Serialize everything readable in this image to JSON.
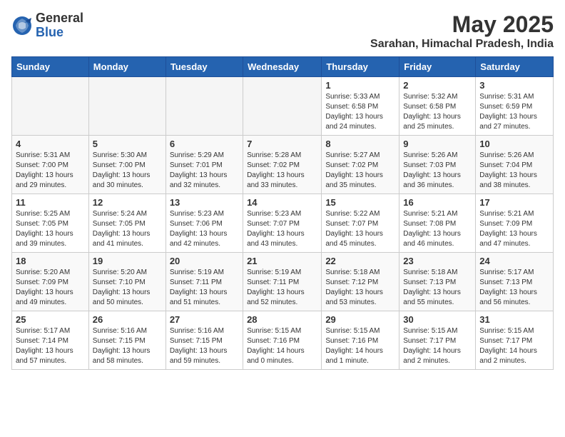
{
  "logo": {
    "general": "General",
    "blue": "Blue"
  },
  "title": "May 2025",
  "location": "Sarahan, Himachal Pradesh, India",
  "days_of_week": [
    "Sunday",
    "Monday",
    "Tuesday",
    "Wednesday",
    "Thursday",
    "Friday",
    "Saturday"
  ],
  "weeks": [
    [
      {
        "day": "",
        "info": ""
      },
      {
        "day": "",
        "info": ""
      },
      {
        "day": "",
        "info": ""
      },
      {
        "day": "",
        "info": ""
      },
      {
        "day": "1",
        "info": "Sunrise: 5:33 AM\nSunset: 6:58 PM\nDaylight: 13 hours\nand 24 minutes."
      },
      {
        "day": "2",
        "info": "Sunrise: 5:32 AM\nSunset: 6:58 PM\nDaylight: 13 hours\nand 25 minutes."
      },
      {
        "day": "3",
        "info": "Sunrise: 5:31 AM\nSunset: 6:59 PM\nDaylight: 13 hours\nand 27 minutes."
      }
    ],
    [
      {
        "day": "4",
        "info": "Sunrise: 5:31 AM\nSunset: 7:00 PM\nDaylight: 13 hours\nand 29 minutes."
      },
      {
        "day": "5",
        "info": "Sunrise: 5:30 AM\nSunset: 7:00 PM\nDaylight: 13 hours\nand 30 minutes."
      },
      {
        "day": "6",
        "info": "Sunrise: 5:29 AM\nSunset: 7:01 PM\nDaylight: 13 hours\nand 32 minutes."
      },
      {
        "day": "7",
        "info": "Sunrise: 5:28 AM\nSunset: 7:02 PM\nDaylight: 13 hours\nand 33 minutes."
      },
      {
        "day": "8",
        "info": "Sunrise: 5:27 AM\nSunset: 7:02 PM\nDaylight: 13 hours\nand 35 minutes."
      },
      {
        "day": "9",
        "info": "Sunrise: 5:26 AM\nSunset: 7:03 PM\nDaylight: 13 hours\nand 36 minutes."
      },
      {
        "day": "10",
        "info": "Sunrise: 5:26 AM\nSunset: 7:04 PM\nDaylight: 13 hours\nand 38 minutes."
      }
    ],
    [
      {
        "day": "11",
        "info": "Sunrise: 5:25 AM\nSunset: 7:05 PM\nDaylight: 13 hours\nand 39 minutes."
      },
      {
        "day": "12",
        "info": "Sunrise: 5:24 AM\nSunset: 7:05 PM\nDaylight: 13 hours\nand 41 minutes."
      },
      {
        "day": "13",
        "info": "Sunrise: 5:23 AM\nSunset: 7:06 PM\nDaylight: 13 hours\nand 42 minutes."
      },
      {
        "day": "14",
        "info": "Sunrise: 5:23 AM\nSunset: 7:07 PM\nDaylight: 13 hours\nand 43 minutes."
      },
      {
        "day": "15",
        "info": "Sunrise: 5:22 AM\nSunset: 7:07 PM\nDaylight: 13 hours\nand 45 minutes."
      },
      {
        "day": "16",
        "info": "Sunrise: 5:21 AM\nSunset: 7:08 PM\nDaylight: 13 hours\nand 46 minutes."
      },
      {
        "day": "17",
        "info": "Sunrise: 5:21 AM\nSunset: 7:09 PM\nDaylight: 13 hours\nand 47 minutes."
      }
    ],
    [
      {
        "day": "18",
        "info": "Sunrise: 5:20 AM\nSunset: 7:09 PM\nDaylight: 13 hours\nand 49 minutes."
      },
      {
        "day": "19",
        "info": "Sunrise: 5:20 AM\nSunset: 7:10 PM\nDaylight: 13 hours\nand 50 minutes."
      },
      {
        "day": "20",
        "info": "Sunrise: 5:19 AM\nSunset: 7:11 PM\nDaylight: 13 hours\nand 51 minutes."
      },
      {
        "day": "21",
        "info": "Sunrise: 5:19 AM\nSunset: 7:11 PM\nDaylight: 13 hours\nand 52 minutes."
      },
      {
        "day": "22",
        "info": "Sunrise: 5:18 AM\nSunset: 7:12 PM\nDaylight: 13 hours\nand 53 minutes."
      },
      {
        "day": "23",
        "info": "Sunrise: 5:18 AM\nSunset: 7:13 PM\nDaylight: 13 hours\nand 55 minutes."
      },
      {
        "day": "24",
        "info": "Sunrise: 5:17 AM\nSunset: 7:13 PM\nDaylight: 13 hours\nand 56 minutes."
      }
    ],
    [
      {
        "day": "25",
        "info": "Sunrise: 5:17 AM\nSunset: 7:14 PM\nDaylight: 13 hours\nand 57 minutes."
      },
      {
        "day": "26",
        "info": "Sunrise: 5:16 AM\nSunset: 7:15 PM\nDaylight: 13 hours\nand 58 minutes."
      },
      {
        "day": "27",
        "info": "Sunrise: 5:16 AM\nSunset: 7:15 PM\nDaylight: 13 hours\nand 59 minutes."
      },
      {
        "day": "28",
        "info": "Sunrise: 5:15 AM\nSunset: 7:16 PM\nDaylight: 14 hours\nand 0 minutes."
      },
      {
        "day": "29",
        "info": "Sunrise: 5:15 AM\nSunset: 7:16 PM\nDaylight: 14 hours\nand 1 minute."
      },
      {
        "day": "30",
        "info": "Sunrise: 5:15 AM\nSunset: 7:17 PM\nDaylight: 14 hours\nand 2 minutes."
      },
      {
        "day": "31",
        "info": "Sunrise: 5:15 AM\nSunset: 7:17 PM\nDaylight: 14 hours\nand 2 minutes."
      }
    ]
  ]
}
